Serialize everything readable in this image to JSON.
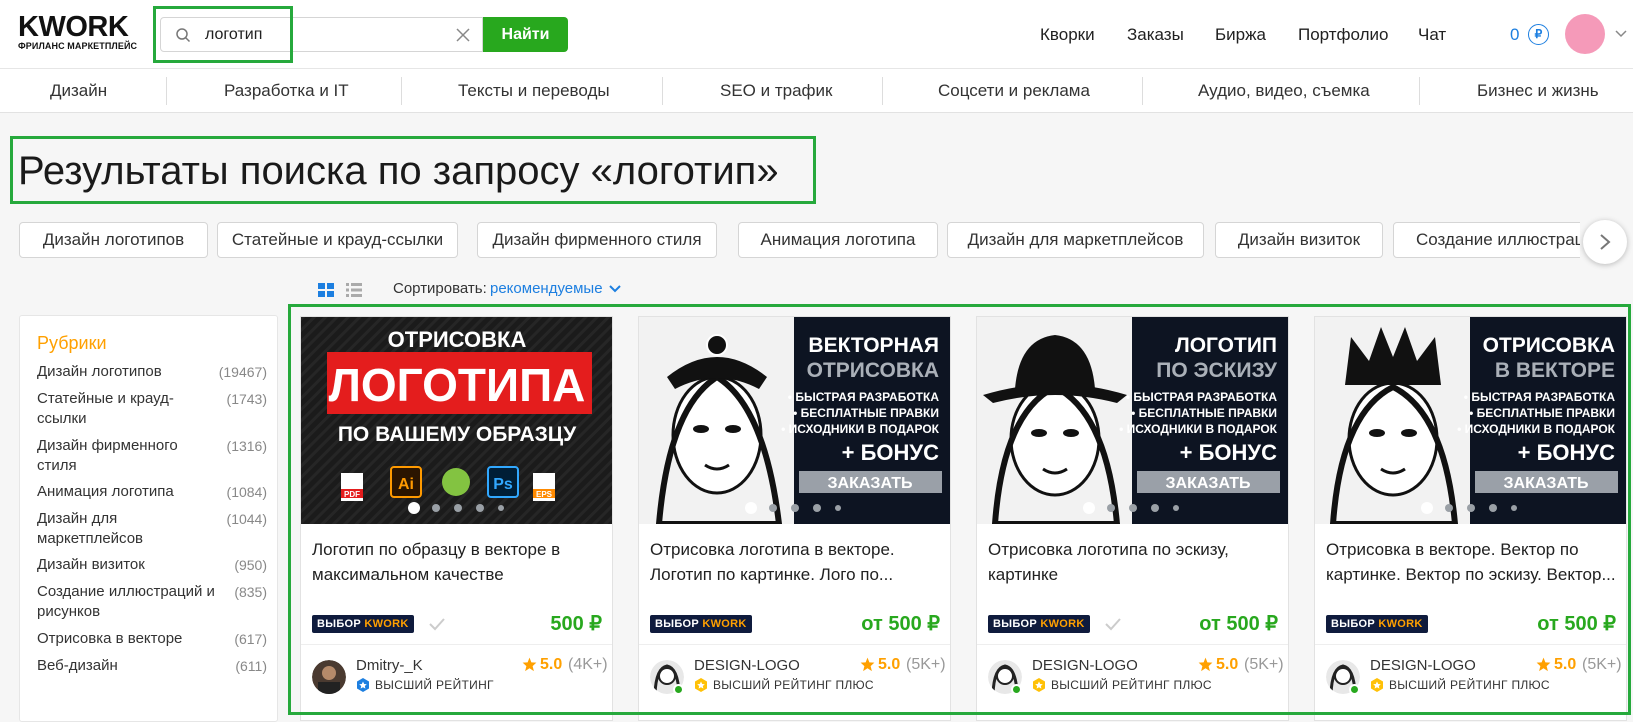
{
  "header": {
    "logo_word": "KWORK",
    "logo_sub": "ФРИЛАНС МАРКЕТПЛЕЙС",
    "search_value": "логотип",
    "search_button": "Найти",
    "nav": [
      "Кворки",
      "Заказы",
      "Биржа",
      "Портфолио",
      "Чат"
    ],
    "balance": "0",
    "currency_symbol": "₽"
  },
  "categories": [
    "Дизайн",
    "Разработка и IT",
    "Тексты и переводы",
    "SEO и трафик",
    "Соцсети и реклама",
    "Аудио, видео, съемка",
    "Бизнес и жизнь"
  ],
  "page_title": "Результаты поиска по запросу «логотип»",
  "tags": [
    "Дизайн логотипов",
    "Статейные и крауд-ссылки",
    "Дизайн фирменного стиля",
    "Анимация логотипа",
    "Дизайн для маркетплейсов",
    "Дизайн визиток",
    "Создание иллюстраций"
  ],
  "sort": {
    "label": "Сортировать:",
    "value": "рекомендуемые"
  },
  "sidebar": {
    "title": "Рубрики",
    "items": [
      {
        "label": "Дизайн логотипов",
        "count": "(19467)"
      },
      {
        "label": "Статейные и крауд-ссылки",
        "count": "(1743)"
      },
      {
        "label": "Дизайн фирменного стиля",
        "count": "(1316)"
      },
      {
        "label": "Анимация логотипа",
        "count": "(1084)"
      },
      {
        "label": "Дизайн для маркетплейсов",
        "count": "(1044)"
      },
      {
        "label": "Дизайн визиток",
        "count": "(950)"
      },
      {
        "label": "Создание иллюстраций и рисунков",
        "count": "(835)"
      },
      {
        "label": "Отрисовка в векторе",
        "count": "(617)"
      },
      {
        "label": "Веб-дизайн",
        "count": "(611)"
      }
    ]
  },
  "badge": {
    "part1": "ВЫБОР",
    "part2": "KWORK"
  },
  "cards": [
    {
      "title": "Логотип по образцу в векторе в\nмаксимальном качестве",
      "price": "500 ₽",
      "seller": "Dmitry-_K",
      "rating": "5.0",
      "reviews": "(4K+)",
      "level": "ВЫСШИЙ РЕЙТИНГ",
      "image": {
        "line1": "ОТРИСОВКА",
        "line2": "ЛОГОТИПА",
        "line3": "ПО ВАШЕМУ ОБРАЗЦУ",
        "icons": [
          "PDF",
          "Ai",
          "Ps",
          "EPS"
        ]
      }
    },
    {
      "title": "Отрисовка логотипа в векторе.\nЛоготип по картинке. Лого по...",
      "price": "от 500 ₽",
      "seller": "DESIGN-LOGO",
      "rating": "5.0",
      "reviews": "(5K+)",
      "level": "ВЫСШИЙ РЕЙТИНГ ПЛЮС",
      "image": {
        "head1": "ВЕКТОРНАЯ",
        "head2": "ОТРИСОВКА",
        "b1": "• БЫСТРАЯ РАЗРАБОТКА",
        "b2": "• БЕСПЛАТНЫЕ ПРАВКИ",
        "b3": "• ИСХОДНИКИ В ПОДАРОК",
        "bonus": "+ БОНУС",
        "cta": "ЗАКАЗАТЬ"
      }
    },
    {
      "title": "Отрисовка логотипа по эскизу,\nкартинке",
      "price": "от 500 ₽",
      "seller": "DESIGN-LOGO",
      "rating": "5.0",
      "reviews": "(5K+)",
      "level": "ВЫСШИЙ РЕЙТИНГ ПЛЮС",
      "image": {
        "head1": "ЛОГОТИП",
        "head2": "ПО ЭСКИЗУ",
        "b1": "• БЫСТРАЯ РАЗРАБОТКА",
        "b2": "• БЕСПЛАТНЫЕ ПРАВКИ",
        "b3": "• ИСХОДНИКИ В ПОДАРОК",
        "bonus": "+ БОНУС",
        "cta": "ЗАКАЗАТЬ"
      }
    },
    {
      "title": "Отрисовка в векторе. Вектор по\nкартинке. Вектор по эскизу. Вектор...",
      "price": "от 500 ₽",
      "seller": "DESIGN-LOGO",
      "rating": "5.0",
      "reviews": "(5K+)",
      "level": "ВЫСШИЙ РЕЙТИНГ ПЛЮС",
      "image": {
        "head1": "ОТРИСОВКА",
        "head2": "В ВЕКТОРЕ",
        "b1": "• БЫСТРАЯ РАЗРАБОТКА",
        "b2": "• БЕСПЛАТНЫЕ ПРАВКИ",
        "b3": "• ИСХОДНИКИ В ПОДАРОК",
        "bonus": "+ БОНУС",
        "cta": "ЗАКАЗАТЬ"
      }
    }
  ],
  "colors": {
    "accent_green": "#28a81e",
    "link_blue": "#1d7fe0",
    "star_orange": "#ffa000",
    "highlight": "#26a93c"
  }
}
